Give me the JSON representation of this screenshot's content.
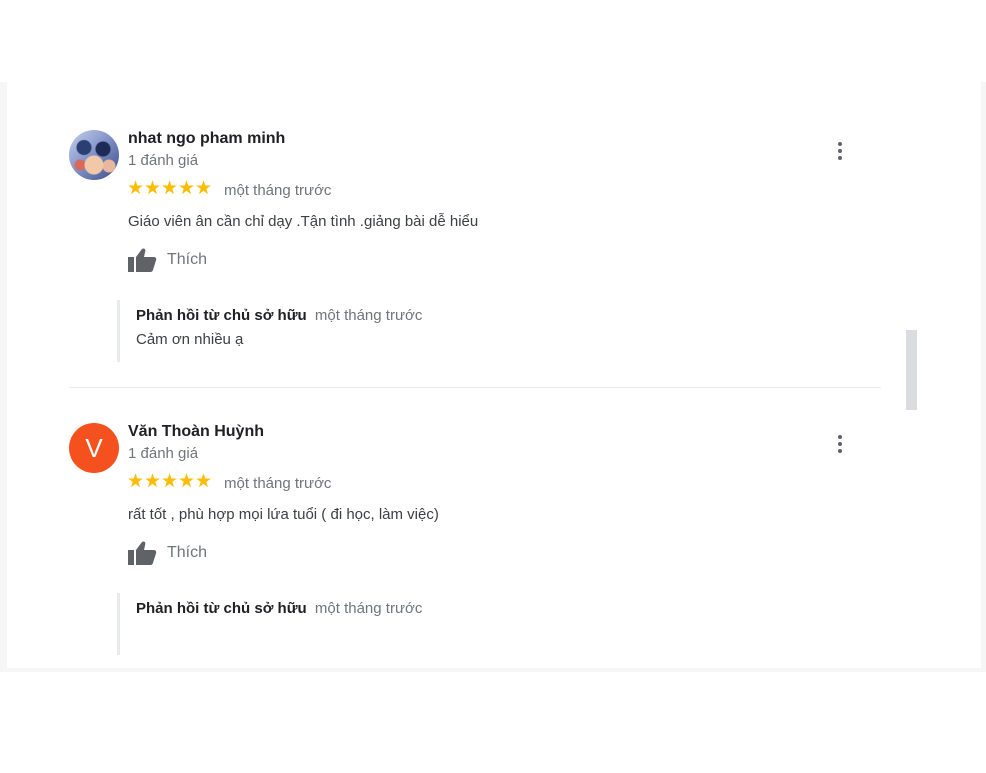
{
  "reviews": [
    {
      "author": "nhat ngo pham minh",
      "review_count": "1 đánh giá",
      "stars": "★★★★★",
      "time": "một tháng trước",
      "text": "Giáo viên ân cần chỉ dạy .Tận tình .giảng bài dễ hiểu",
      "like_label": "Thích",
      "avatar": "photo",
      "reply": {
        "author": "Phản hồi từ chủ sở hữu",
        "time": "một tháng trước",
        "text": "Cảm ơn nhiều ạ"
      }
    },
    {
      "author": "Văn Thoàn Huỳnh",
      "review_count": "1 đánh giá",
      "stars": "★★★★★",
      "time": "một tháng trước",
      "text": "rất tốt , phù hợp mọi lứa tuổi ( đi học, làm việc)",
      "like_label": "Thích",
      "avatar_letter": "V",
      "avatar_color": "#f4511e",
      "reply": {
        "author": "Phản hồi từ chủ sở hữu",
        "time": "một tháng trước"
      }
    }
  ],
  "colors": {
    "star": "#fbbc04",
    "muted_text": "#70757a",
    "title_text": "#202124"
  },
  "icons": {
    "like": "thumbs-up-icon",
    "menu": "more-vert-icon"
  }
}
